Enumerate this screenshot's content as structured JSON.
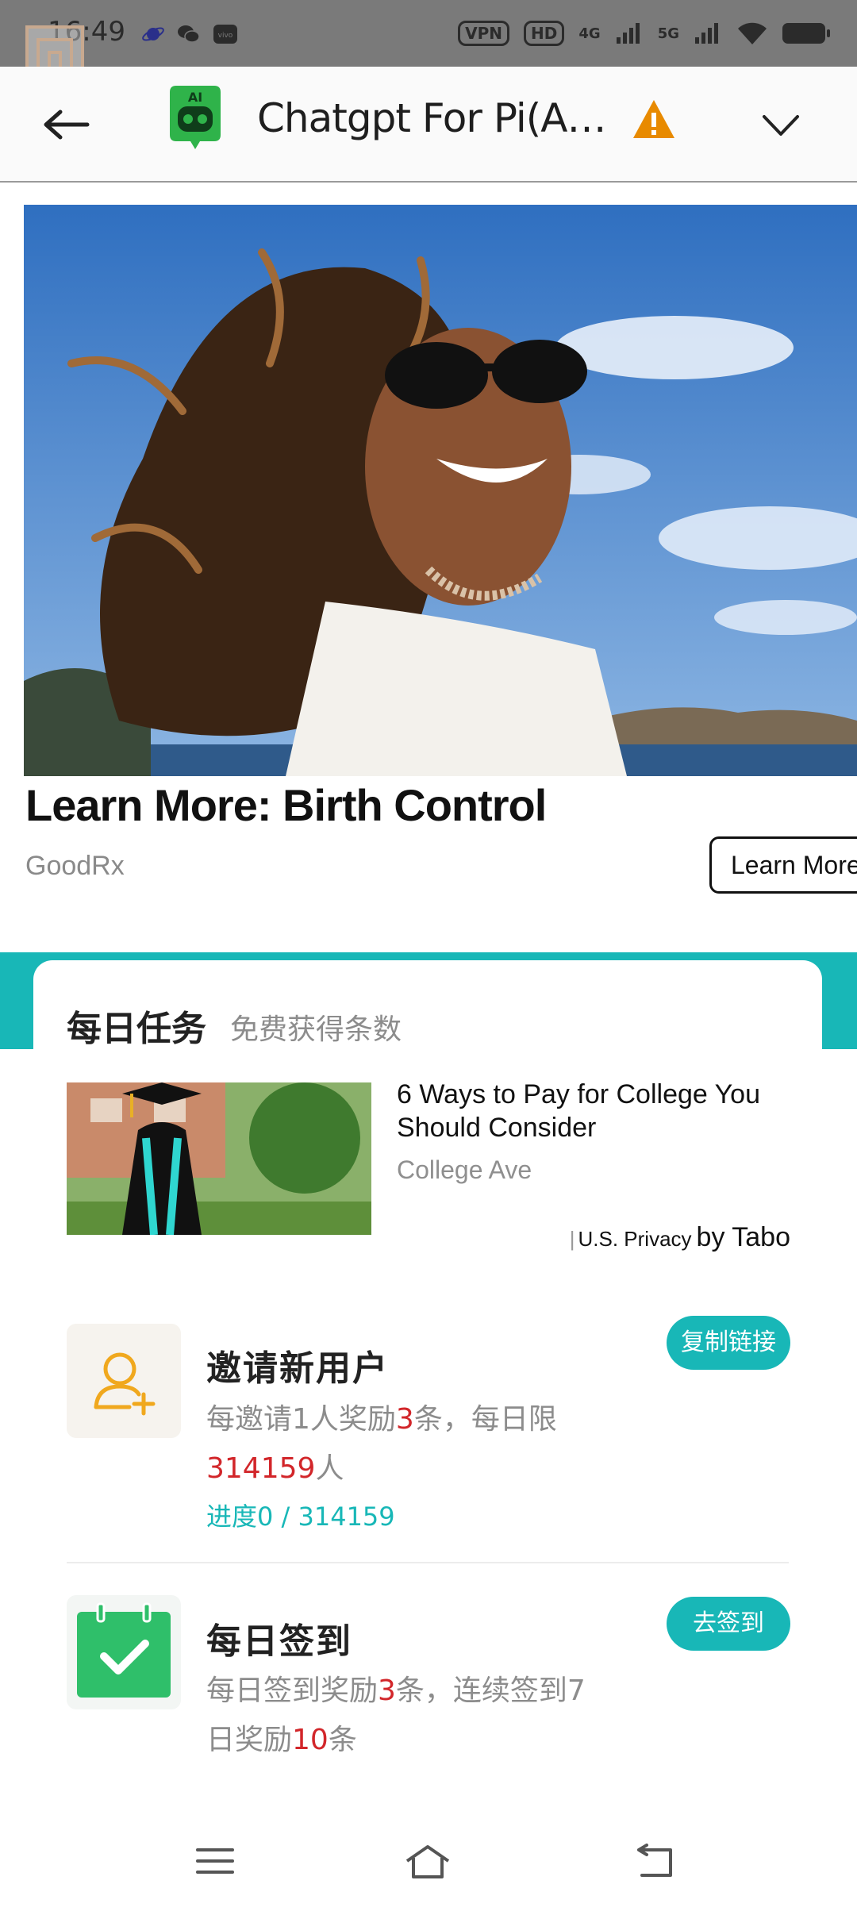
{
  "status_bar": {
    "time": "16:49",
    "vpn": "VPN",
    "hd": "HD",
    "network_1": "4G",
    "network_2": "5G",
    "icons": [
      "saturn-app-icon",
      "wechat-icon",
      "vivo-icon",
      "wifi-icon",
      "battery-icon"
    ]
  },
  "header": {
    "title": "Chatgpt For Pi(Ai Chat)",
    "icons": [
      "back-arrow-icon",
      "ai-robot-logo",
      "warning-icon",
      "chevron-down-icon"
    ],
    "logo_text": "AI",
    "accent_color": "#2fb34a",
    "warning_color": "#e88a00"
  },
  "ad": {
    "headline": "Learn More: Birth Control",
    "source": "GoodRx",
    "cta": "Learn More"
  },
  "tasks": {
    "title": "每日任务",
    "subtitle": "免费获得条数",
    "native_ad": {
      "title": "6 Ways to Pay for College You Should Consider",
      "source": "College Ave",
      "privacy": "U.S. Privacy",
      "by": "by Tabo"
    },
    "invite": {
      "title": "邀请新用户",
      "desc_1": "每邀请1人奖励",
      "reward": "3",
      "desc_2": "条，每日限",
      "limit": "314159",
      "desc_3": "人",
      "progress": "进度0 / 314159",
      "button": "复制链接",
      "icon": "user-add-icon"
    },
    "checkin": {
      "title": "每日签到",
      "desc_1": "每日签到奖励",
      "reward": "3",
      "desc_2": "条，连续签到7",
      "desc_3": "日奖励",
      "bonus": "10",
      "desc_4": "条",
      "button": "去签到",
      "icon": "calendar-check-icon"
    },
    "accent_color": "#18b7b7",
    "highlight_color": "#d2262a"
  },
  "nav": {
    "icons": [
      "menu-icon",
      "home-icon",
      "back-icon"
    ]
  }
}
